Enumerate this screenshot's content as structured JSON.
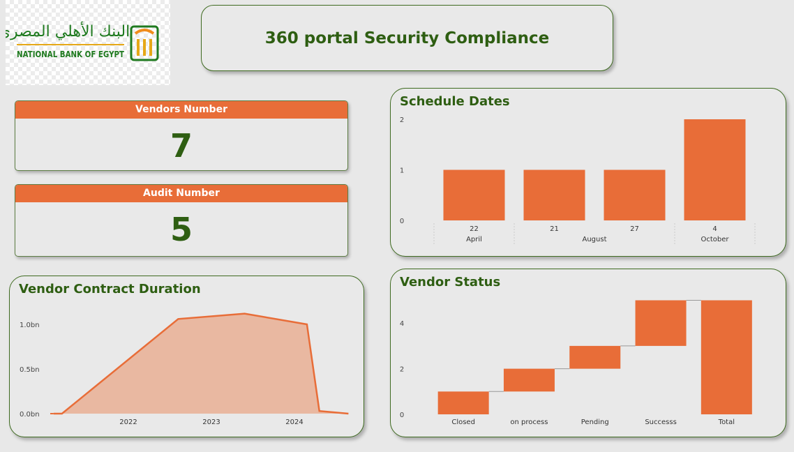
{
  "logo": {
    "arabic": "البنك الأهلي المصري",
    "english": "NATIONAL BANK OF EGYPT",
    "colors": {
      "green": "#1f7a1f",
      "gold": "#e6a817",
      "orange": "#f08c1c"
    }
  },
  "header": {
    "title": "360 portal Security Compliance"
  },
  "kpis": [
    {
      "label": "Vendors Number",
      "value": "7"
    },
    {
      "label": "Audit Number",
      "value": "5"
    }
  ],
  "colors": {
    "accent": "#e86d38",
    "title_green": "#2e5e12",
    "area_fill": "#e9b8a1"
  },
  "chart_data": [
    {
      "type": "bar",
      "title": "Schedule Dates",
      "categories": [
        "22",
        "21",
        "27",
        "4"
      ],
      "groups": [
        {
          "label": "April",
          "categories": [
            "22"
          ]
        },
        {
          "label": "August",
          "categories": [
            "21",
            "27"
          ]
        },
        {
          "label": "October",
          "categories": [
            "4"
          ]
        }
      ],
      "values": [
        1,
        1,
        1,
        2
      ],
      "yticks": [
        "0",
        "1",
        "2"
      ],
      "ylim": [
        0,
        2
      ]
    },
    {
      "type": "area",
      "title": "Vendor Contract Duration",
      "x": [
        2021.1,
        2021.2,
        2022.6,
        2023.4,
        2024.15,
        2024.3,
        2024.65
      ],
      "y": [
        0,
        0,
        1.06,
        1.12,
        1.0,
        0.03,
        0
      ],
      "xticks": [
        "2022",
        "2023",
        "2024"
      ],
      "yticks": [
        "0.0bn",
        "0.5bn",
        "1.0bn"
      ],
      "ylim": [
        0,
        1.25
      ]
    },
    {
      "type": "bar",
      "title": "Vendor Status",
      "categories": [
        "Closed",
        "on process",
        "Pending",
        "Successs",
        "Total"
      ],
      "waterfall": [
        {
          "start": 0,
          "end": 1
        },
        {
          "start": 1,
          "end": 2
        },
        {
          "start": 2,
          "end": 3
        },
        {
          "start": 3,
          "end": 5
        },
        {
          "start": 0,
          "end": 5
        }
      ],
      "yticks": [
        "0",
        "2",
        "4"
      ],
      "ylim": [
        0,
        5
      ]
    }
  ]
}
